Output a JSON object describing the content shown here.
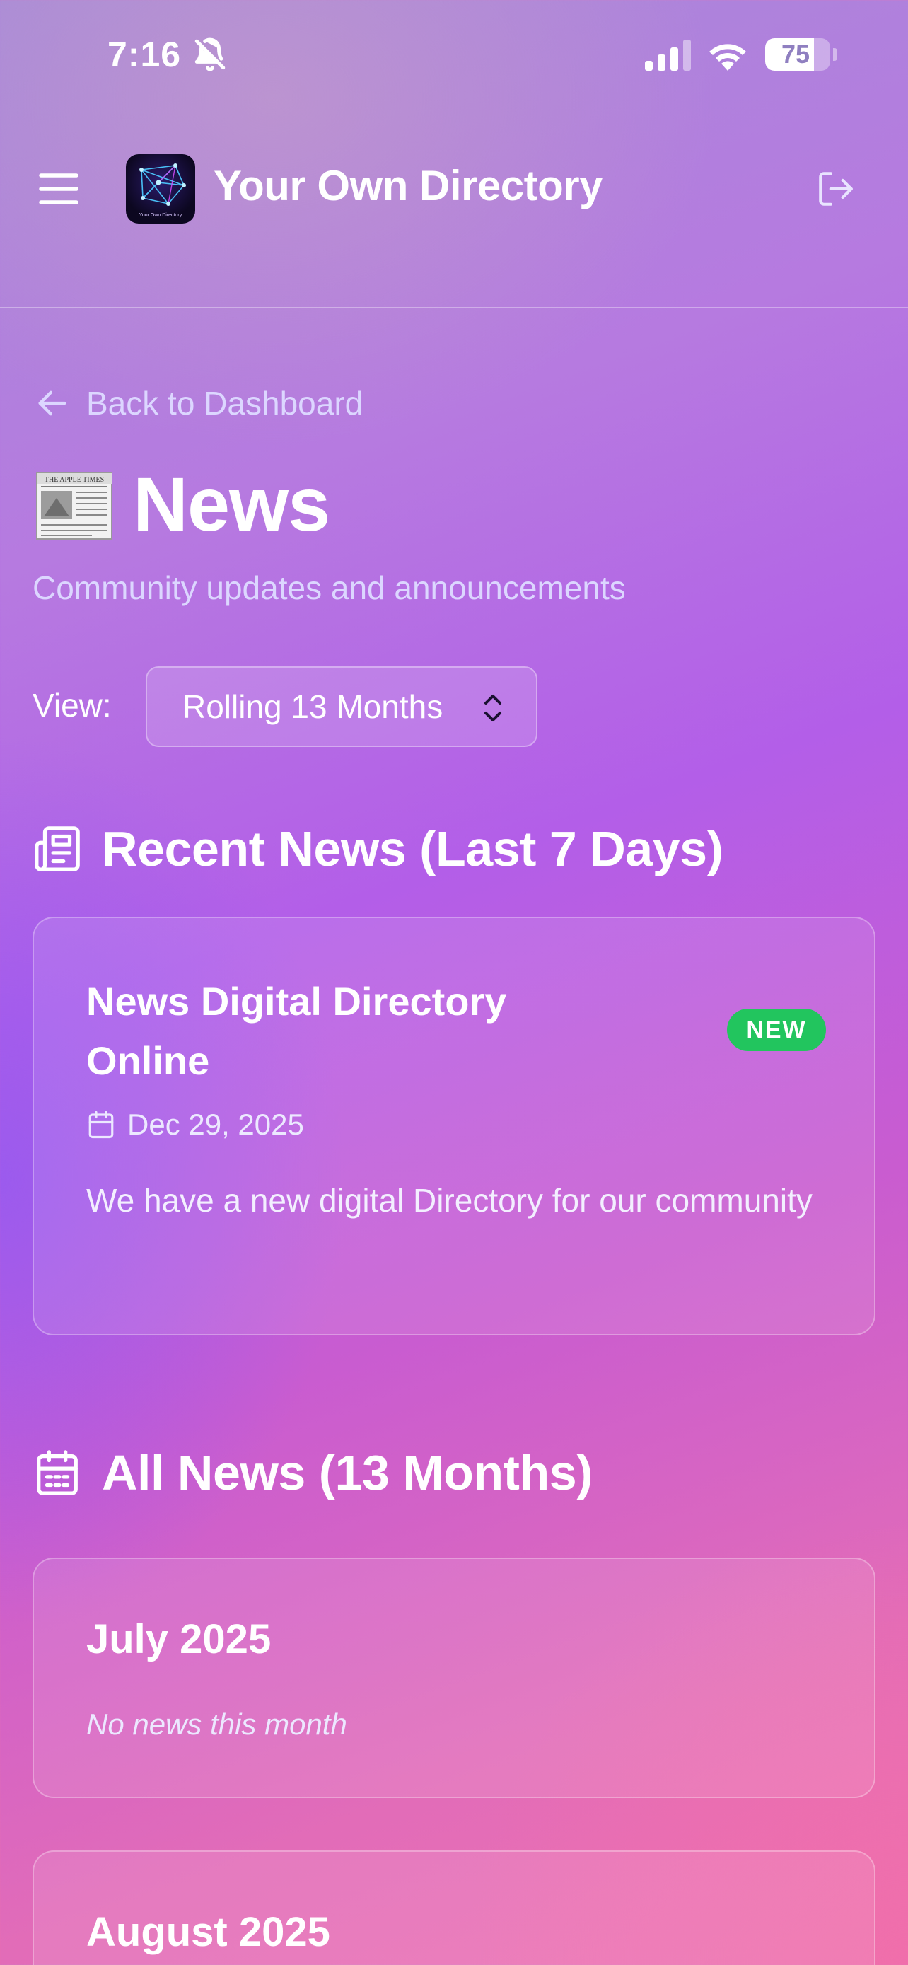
{
  "status_bar": {
    "time": "7:16",
    "battery": "75",
    "battery_level": 0.75
  },
  "header": {
    "app_title": "Your Own Directory",
    "logo_text": "Your Own Directory"
  },
  "back_link": {
    "label": "Back to Dashboard"
  },
  "page": {
    "title": "News",
    "subtitle": "Community updates and announcements",
    "newspaper_masthead": "THE APPLE TIMES"
  },
  "view": {
    "label": "View:",
    "selected": "Rolling 13 Months"
  },
  "recent": {
    "heading": "Recent News (Last 7 Days)",
    "items": [
      {
        "title": "News Digital Directory Online",
        "badge": "NEW",
        "date": "Dec 29, 2025",
        "body": "We have a new digital Directory for our community"
      }
    ]
  },
  "all": {
    "heading": "All News (13 Months)",
    "months": [
      {
        "title": "July 2025",
        "empty": "No news this month"
      },
      {
        "title": "August 2025"
      }
    ]
  },
  "colors": {
    "badge_green": "#22c55e",
    "link_lilac": "#dcd6ff"
  }
}
